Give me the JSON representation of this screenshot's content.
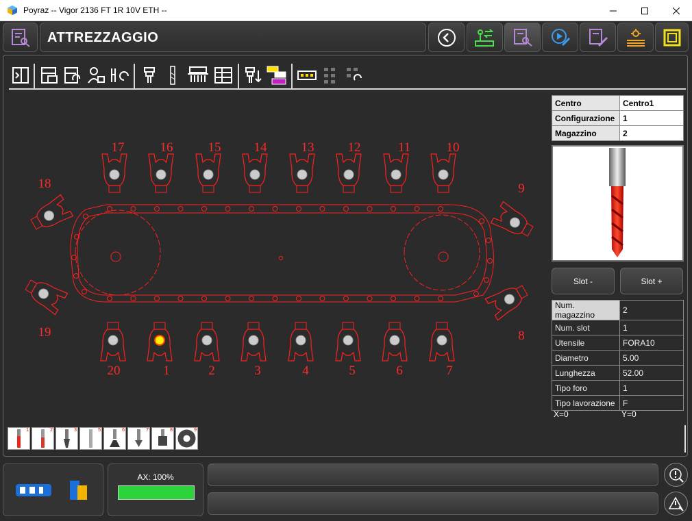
{
  "window": {
    "title": "Poyraz -- Vigor 2136 FT 1R 10V ETH --"
  },
  "header": {
    "page_title": "ATTREZZAGGIO",
    "nav_buttons": [
      "back-icon",
      "machine-transfer-icon",
      "tooling-setup-icon",
      "program-edit-icon",
      "setup-edit-icon",
      "heating-icon",
      "frame-icon"
    ]
  },
  "magazine": {
    "slot_numbers": [
      "1",
      "2",
      "3",
      "4",
      "5",
      "6",
      "7",
      "8",
      "9",
      "10",
      "11",
      "12",
      "13",
      "14",
      "15",
      "16",
      "17",
      "18",
      "19",
      "20"
    ],
    "selected_slot": 1,
    "colors": {
      "chain": "#ff2020",
      "selected_fill": "#ffee00",
      "empty_fill": "#cccccc"
    }
  },
  "center_info": {
    "rows": [
      {
        "key": "Centro",
        "value": "Centro1"
      },
      {
        "key": "Configurazione",
        "value": "1"
      },
      {
        "key": "Magazzino",
        "value": "2"
      }
    ]
  },
  "slot_buttons": {
    "prev": "Slot -",
    "next": "Slot +"
  },
  "tool_details": {
    "rows": [
      {
        "key": "Num. magazzino",
        "value": "2"
      },
      {
        "key": "Num. slot",
        "value": "1"
      },
      {
        "key": "Utensile",
        "value": "FORA10"
      },
      {
        "key": "Diametro",
        "value": "5.00"
      },
      {
        "key": "Lunghezza",
        "value": "52.00"
      },
      {
        "key": "Tipo foro",
        "value": "1"
      },
      {
        "key": "Tipo lavorazione",
        "value": "F"
      }
    ]
  },
  "coords": {
    "x": "X=0",
    "y": "Y=0"
  },
  "tool_strip": [
    "1",
    "2",
    "3",
    "5",
    "6",
    "7",
    "8",
    "9"
  ],
  "status": {
    "axis_label": "AX: 100%",
    "axis_progress_pct": 100,
    "axis_color": "#2bd43a"
  }
}
